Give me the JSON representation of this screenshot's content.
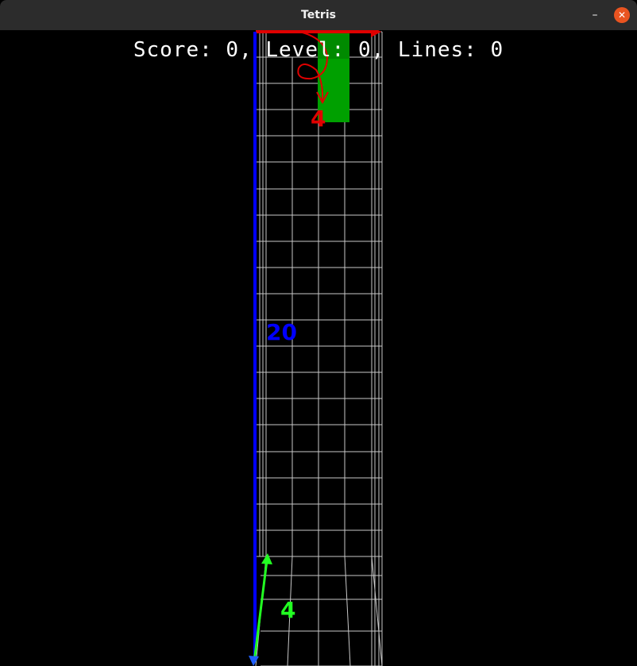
{
  "window": {
    "title": "Tetris",
    "minimize_icon": "–",
    "close_icon": "✕"
  },
  "hud": {
    "text": "Score: 0, Level: 0, Lines: 0"
  },
  "axes": {
    "width_label": "4",
    "height_label": "20",
    "depth_label": "4",
    "width_color": "#e00000",
    "height_color": "#0000ff",
    "depth_color": "#22ff22"
  },
  "piece": {
    "color": "#00a000"
  }
}
